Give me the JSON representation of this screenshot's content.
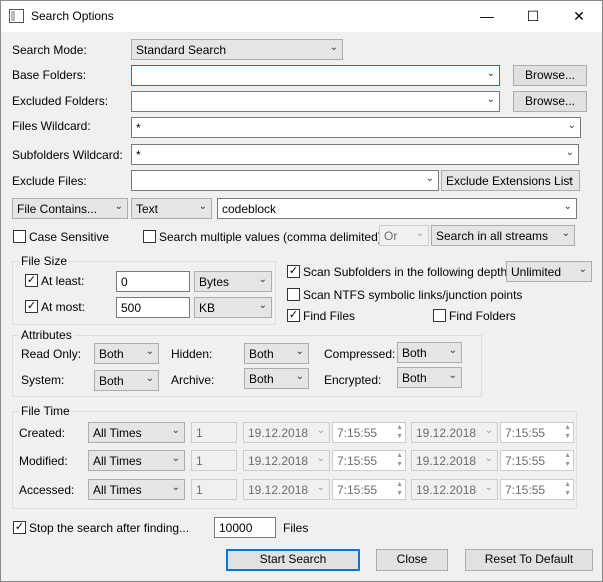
{
  "window": {
    "title": "Search Options",
    "minimize": "—",
    "maximize": "☐",
    "close": "✕"
  },
  "search_mode": {
    "label": "Search Mode:",
    "value": "Standard Search"
  },
  "base_folders": {
    "label": "Base Folders:",
    "value": "",
    "browse": "Browse..."
  },
  "excluded_folders": {
    "label": "Excluded Folders:",
    "value": "",
    "browse": "Browse..."
  },
  "files_wildcard": {
    "label": "Files Wildcard:",
    "value": "*"
  },
  "subfolders_wildcard": {
    "label": "Subfolders Wildcard:",
    "value": "*"
  },
  "exclude_files": {
    "label": "Exclude Files:",
    "value": "",
    "list": "Exclude Extensions List"
  },
  "content": {
    "mode": "File Contains...",
    "type": "Text",
    "value": "codeblock"
  },
  "options": {
    "case_sensitive": {
      "label": "Case Sensitive",
      "checked": false
    },
    "multiple_values": {
      "label": "Search multiple values (comma delimited)",
      "checked": false
    },
    "or_value": "Or",
    "streams": "Search in all streams"
  },
  "file_size": {
    "title": "File Size",
    "at_least": {
      "label": "At least:",
      "checked": true,
      "value": "0",
      "unit": "Bytes"
    },
    "at_most": {
      "label": "At most:",
      "checked": true,
      "value": "500",
      "unit": "KB"
    }
  },
  "scan": {
    "subfolders": {
      "label": "Scan Subfolders in the following depth:",
      "checked": true,
      "depth": "Unlimited"
    },
    "ntfs": {
      "label": "Scan NTFS symbolic links/junction points",
      "checked": false
    },
    "find_files": {
      "label": "Find Files",
      "checked": true
    },
    "find_folders": {
      "label": "Find Folders",
      "checked": false
    }
  },
  "attributes": {
    "title": "Attributes",
    "read_only": {
      "label": "Read Only:",
      "value": "Both"
    },
    "hidden": {
      "label": "Hidden:",
      "value": "Both"
    },
    "compressed": {
      "label": "Compressed:",
      "value": "Both"
    },
    "system": {
      "label": "System:",
      "value": "Both"
    },
    "archive": {
      "label": "Archive:",
      "value": "Both"
    },
    "encrypted": {
      "label": "Encrypted:",
      "value": "Both"
    }
  },
  "file_time": {
    "title": "File Time",
    "rows": [
      {
        "label": "Created:",
        "mode": "All Times",
        "count": "1",
        "date1": "19.12.2018",
        "time1": "7:15:55",
        "date2": "19.12.2018",
        "time2": "7:15:55"
      },
      {
        "label": "Modified:",
        "mode": "All Times",
        "count": "1",
        "date1": "19.12.2018",
        "time1": "7:15:55",
        "date2": "19.12.2018",
        "time2": "7:15:55"
      },
      {
        "label": "Accessed:",
        "mode": "All Times",
        "count": "1",
        "date1": "19.12.2018",
        "time1": "7:15:55",
        "date2": "19.12.2018",
        "time2": "7:15:55"
      }
    ]
  },
  "stop_after": {
    "label": "Stop the search after finding...",
    "checked": true,
    "value": "10000",
    "suffix": "Files"
  },
  "buttons": {
    "start": "Start Search",
    "close": "Close",
    "reset": "Reset To Default"
  }
}
